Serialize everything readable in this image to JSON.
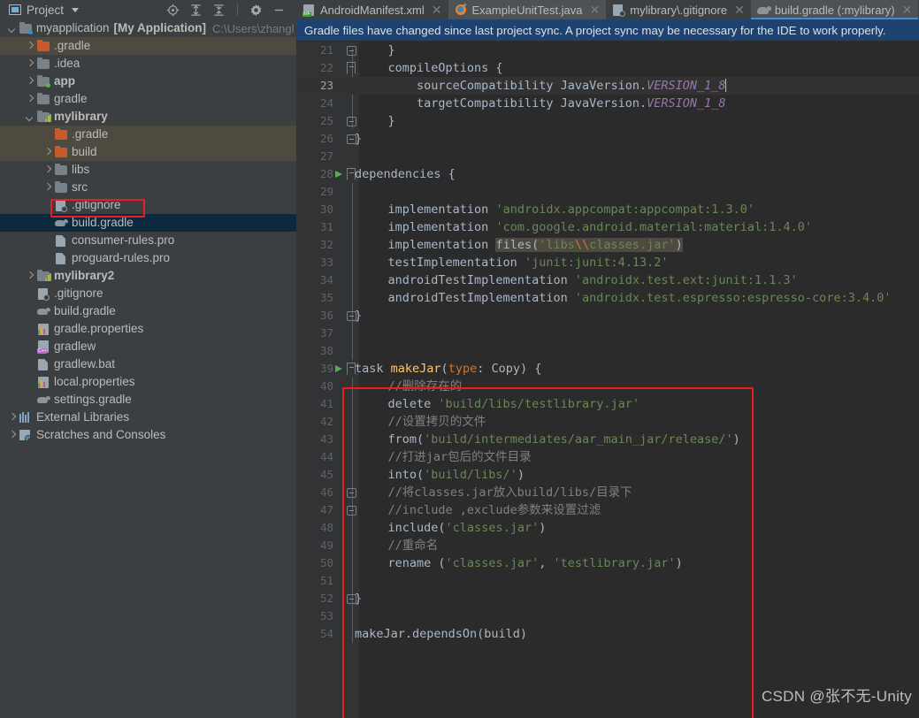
{
  "project_panel": {
    "title": "Project",
    "icons": [
      "locate-icon",
      "expand-all-icon",
      "collapse-all-icon",
      "settings-gear-icon",
      "hide-panel-icon"
    ],
    "tree": [
      {
        "depth": 0,
        "arrow": "down",
        "icon": "module-folder-icon",
        "label": "myapplication",
        "bold_label": "[My Application]",
        "path": "C:\\Users\\zhangl",
        "state": "normal"
      },
      {
        "depth": 1,
        "arrow": "right",
        "icon": "folder-orange-icon",
        "label": ".gradle",
        "state": "highlight"
      },
      {
        "depth": 1,
        "arrow": "right",
        "icon": "folder-grey-icon",
        "label": ".idea",
        "state": "normal"
      },
      {
        "depth": 1,
        "arrow": "right",
        "icon": "module-android-icon",
        "label": "app",
        "state": "normal",
        "bold": true
      },
      {
        "depth": 1,
        "arrow": "right",
        "icon": "folder-grey-icon",
        "label": "gradle",
        "state": "normal"
      },
      {
        "depth": 1,
        "arrow": "down",
        "icon": "module-library-icon",
        "label": "mylibrary",
        "state": "normal",
        "bold": true
      },
      {
        "depth": 2,
        "arrow": "none",
        "icon": "folder-orange-icon",
        "label": ".gradle",
        "state": "highlight"
      },
      {
        "depth": 2,
        "arrow": "right",
        "icon": "folder-orange-icon",
        "label": "build",
        "state": "highlight"
      },
      {
        "depth": 2,
        "arrow": "right",
        "icon": "folder-grey-icon",
        "label": "libs",
        "state": "normal"
      },
      {
        "depth": 2,
        "arrow": "right",
        "icon": "folder-grey-icon",
        "label": "src",
        "state": "normal"
      },
      {
        "depth": 2,
        "arrow": "none",
        "icon": "gitignore-file-icon",
        "label": ".gitignore",
        "state": "normal"
      },
      {
        "depth": 2,
        "arrow": "none",
        "icon": "gradle-file-icon",
        "label": "build.gradle",
        "state": "selected"
      },
      {
        "depth": 2,
        "arrow": "none",
        "icon": "text-file-icon",
        "label": "consumer-rules.pro",
        "state": "normal"
      },
      {
        "depth": 2,
        "arrow": "none",
        "icon": "text-file-icon",
        "label": "proguard-rules.pro",
        "state": "normal"
      },
      {
        "depth": 1,
        "arrow": "right",
        "icon": "module-library-icon",
        "label": "mylibrary2",
        "state": "normal",
        "bold": true
      },
      {
        "depth": 1,
        "arrow": "none",
        "icon": "gitignore-file-icon",
        "label": ".gitignore",
        "state": "normal"
      },
      {
        "depth": 1,
        "arrow": "none",
        "icon": "gradle-file-icon",
        "label": "build.gradle",
        "state": "normal"
      },
      {
        "depth": 1,
        "arrow": "none",
        "icon": "properties-file-icon",
        "label": "gradle.properties",
        "state": "normal"
      },
      {
        "depth": 1,
        "arrow": "none",
        "icon": "script-file-icon",
        "label": "gradlew",
        "state": "normal"
      },
      {
        "depth": 1,
        "arrow": "none",
        "icon": "text-file-icon",
        "label": "gradlew.bat",
        "state": "normal"
      },
      {
        "depth": 1,
        "arrow": "none",
        "icon": "properties-file-icon",
        "label": "local.properties",
        "state": "normal"
      },
      {
        "depth": 1,
        "arrow": "none",
        "icon": "gradle-file-icon",
        "label": "settings.gradle",
        "state": "normal"
      },
      {
        "depth": 0,
        "arrow": "right",
        "icon": "external-libraries-icon",
        "label": "External Libraries",
        "state": "normal"
      },
      {
        "depth": 0,
        "arrow": "right",
        "icon": "scratches-icon",
        "label": "Scratches and Consoles",
        "state": "normal"
      }
    ]
  },
  "tabs": [
    {
      "label": "AndroidManifest.xml",
      "icon": "manifest-file-icon",
      "active": false
    },
    {
      "label": "ExampleUnitTest.java",
      "icon": "java-file-icon",
      "active": false
    },
    {
      "label": "mylibrary\\.gitignore",
      "icon": "gitignore-file-icon",
      "active": false
    },
    {
      "label": "build.gradle (:mylibrary)",
      "icon": "gradle-file-icon",
      "active": true
    }
  ],
  "notification": {
    "message": "Gradle files have changed since last project sync. A project sync may be necessary for the IDE to work properly."
  },
  "editor": {
    "first_line": 21,
    "current_line": 23,
    "lines": [
      {
        "n": 21,
        "text": "    }"
      },
      {
        "n": 22,
        "text": "    compileOptions {"
      },
      {
        "n": 23,
        "text": "        sourceCompatibility JavaVersion.VERSION_1_8"
      },
      {
        "n": 24,
        "text": "        targetCompatibility JavaVersion.VERSION_1_8"
      },
      {
        "n": 25,
        "text": "    }"
      },
      {
        "n": 26,
        "text": "}"
      },
      {
        "n": 27,
        "text": ""
      },
      {
        "n": 28,
        "text": "dependencies {"
      },
      {
        "n": 29,
        "text": ""
      },
      {
        "n": 30,
        "text": "    implementation 'androidx.appcompat:appcompat:1.3.0'"
      },
      {
        "n": 31,
        "text": "    implementation 'com.google.android.material:material:1.4.0'"
      },
      {
        "n": 32,
        "text": "    implementation files('libs\\\\classes.jar')"
      },
      {
        "n": 33,
        "text": "    testImplementation 'junit:junit:4.13.2'"
      },
      {
        "n": 34,
        "text": "    androidTestImplementation 'androidx.test.ext:junit:1.1.3'"
      },
      {
        "n": 35,
        "text": "    androidTestImplementation 'androidx.test.espresso:espresso-core:3.4.0'"
      },
      {
        "n": 36,
        "text": "}"
      },
      {
        "n": 37,
        "text": ""
      },
      {
        "n": 38,
        "text": ""
      },
      {
        "n": 39,
        "text": "task makeJar(type: Copy) {"
      },
      {
        "n": 40,
        "text": "    //删除存在的"
      },
      {
        "n": 41,
        "text": "    delete 'build/libs/testlibrary.jar'"
      },
      {
        "n": 42,
        "text": "    //设置拷贝的文件"
      },
      {
        "n": 43,
        "text": "    from('build/intermediates/aar_main_jar/release/')"
      },
      {
        "n": 44,
        "text": "    //打进jar包后的文件目录"
      },
      {
        "n": 45,
        "text": "    into('build/libs/')"
      },
      {
        "n": 46,
        "text": "    //将classes.jar放入build/libs/目录下"
      },
      {
        "n": 47,
        "text": "    //include ,exclude参数来设置过滤"
      },
      {
        "n": 48,
        "text": "    include('classes.jar')"
      },
      {
        "n": 49,
        "text": "    //重命名"
      },
      {
        "n": 50,
        "text": "    rename ('classes.jar', 'testlibrary.jar')"
      },
      {
        "n": 51,
        "text": ""
      },
      {
        "n": 52,
        "text": "}"
      },
      {
        "n": 53,
        "text": ""
      },
      {
        "n": 54,
        "text": "makeJar.dependsOn(build)"
      }
    ]
  },
  "watermark": "CSDN @张不无-Unity",
  "colors": {
    "panel_bg": "#3c3f41",
    "editor_bg": "#2b2b2b",
    "gutter_bg": "#313335",
    "selection": "#0d293e",
    "highlight_row": "#4e4a3f",
    "notice_bg": "#1e4370",
    "accent_tab": "#4a88c7",
    "annotation_red": "#ee1c1c",
    "keyword": "#cc7832",
    "string": "#6a8759",
    "comment": "#808080",
    "function": "#ffc66d",
    "field": "#9876aa",
    "default_text": "#a9b7c6"
  }
}
